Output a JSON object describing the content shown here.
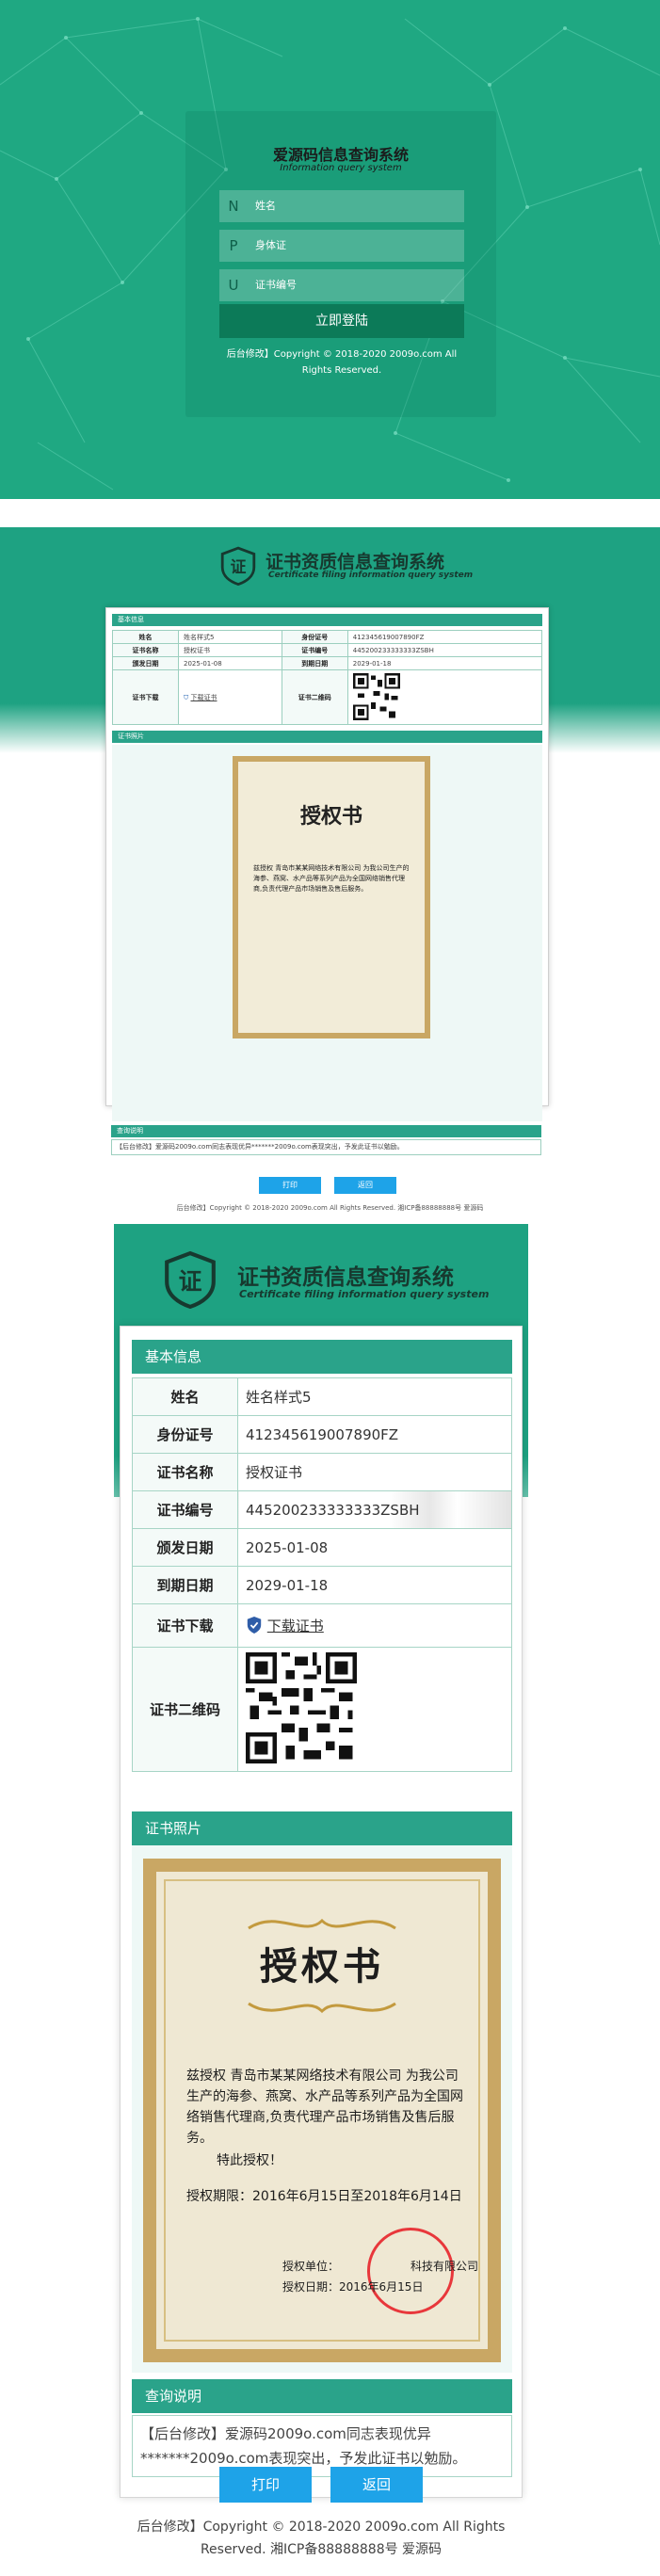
{
  "login": {
    "title": "爱源码信息查询系统",
    "subtitle": "Information query system",
    "fields": [
      {
        "icon": "N",
        "placeholder": "姓名"
      },
      {
        "icon": "P",
        "placeholder": "身体证"
      },
      {
        "icon": "U",
        "placeholder": "证书编号"
      }
    ],
    "submit_label": "立即登陆",
    "copyright": "后台修改】Copyright © 2018-2020 2009o.com All Rights Reserved."
  },
  "header": {
    "logo_char": "证",
    "title": "证书资质信息查询系统",
    "subtitle": "Certificate filing information query system"
  },
  "basic_info": {
    "section_label": "基本信息",
    "rows": [
      {
        "label": "姓名",
        "value": "姓名样式5"
      },
      {
        "label": "身份证号",
        "value": "412345619007890FZ"
      },
      {
        "label": "证书名称",
        "value": "授权证书"
      },
      {
        "label": "证书编号",
        "value": "445200233333333ZSBH"
      },
      {
        "label": "颁发日期",
        "value": "2025-01-08"
      },
      {
        "label": "到期日期",
        "value": "2029-01-18"
      },
      {
        "label": "证书下载",
        "value": "下载证书"
      },
      {
        "label": "证书二维码",
        "value": ""
      }
    ]
  },
  "photo": {
    "section_label": "证书照片",
    "cert_title": "授权书",
    "cert_body": "兹授权 青岛市某某网络技术有限公司 为我公司生产的海参、燕窝、水产品等系列产品为全国网络销售代理商,负责代理产品市场销售及售后服务。",
    "cert_special": "特此授权！",
    "cert_period": "授权期限：2016年6月15日至2018年6月14日",
    "cert_unit": "授权单位：",
    "cert_unit_name": "科技有限公司",
    "cert_date": "授权日期：2016年6月15日"
  },
  "notes": {
    "section_label": "查询说明",
    "text": "【后台修改】爱源码2009o.com同志表现优异*******2009o.com表现突出，予发此证书以勉励。"
  },
  "buttons": {
    "print": "打印",
    "back": "返回"
  },
  "footer": {
    "text": "后台修改】Copyright © 2018-2020 2009o.com All Rights Reserved. 湘ICP备88888888号 爱源码"
  },
  "colors": {
    "brand": "#1fa882",
    "band": "#2aa38a",
    "button": "#1ea3e8",
    "seal": "#e8373b"
  }
}
